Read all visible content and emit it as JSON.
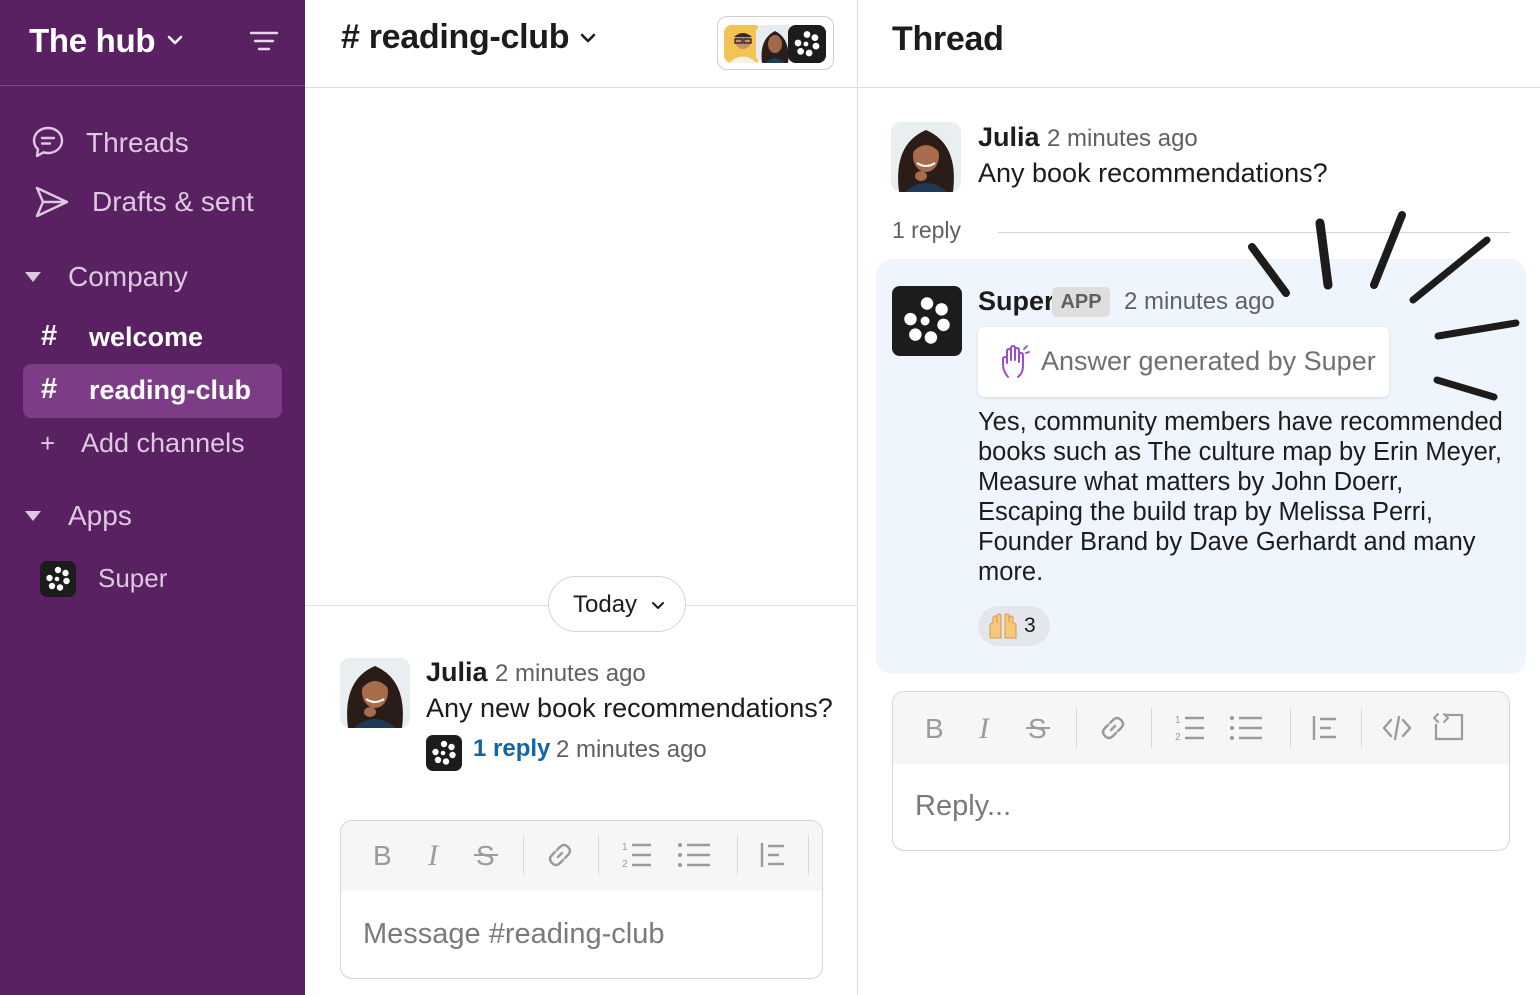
{
  "sidebar": {
    "workspace": "The hub",
    "nav": [
      {
        "label": "Threads",
        "icon": "threads-icon"
      },
      {
        "label": "Drafts & sent",
        "icon": "send-icon"
      }
    ],
    "sections": [
      {
        "label": "Company",
        "icon": "caret-down-icon"
      },
      {
        "label": "Apps",
        "icon": "caret-down-icon"
      }
    ],
    "channels": [
      {
        "hash": "#",
        "label": "welcome",
        "active": false
      },
      {
        "hash": "#",
        "label": "reading-club",
        "active": true
      }
    ],
    "add_channels": {
      "plus": "+",
      "label": "Add channels"
    },
    "apps": [
      {
        "label": "Super",
        "icon": "super-app-icon"
      }
    ]
  },
  "channel": {
    "title": "# reading-club",
    "day_divider": "Today",
    "message": {
      "user": "Julia",
      "time": "2 minutes ago",
      "text": "Any new book recommendations?",
      "reply_link": "1 reply",
      "reply_time": "2 minutes ago"
    },
    "composer": {
      "placeholder": "Message  #reading-club",
      "toolbar": [
        "B",
        "I",
        "S",
        "link",
        "numbered-list",
        "bulleted-list",
        "blockquote"
      ]
    }
  },
  "thread": {
    "title": "Thread",
    "parent": {
      "user": "Julia",
      "time": "2 minutes ago",
      "text": "Any book recommendations?"
    },
    "reply_count": "1 reply",
    "reply": {
      "user": "Super",
      "badge": "APP",
      "time": "2 minutes ago",
      "generated_label": "Answer generated by Super",
      "answer_lines": [
        "Yes, community members have recommended",
        "books such as The culture map by Erin Meyer,",
        "Measure what matters by John Doerr,",
        "Escaping the build trap by  Melissa Perri,",
        "Founder Brand by Dave Gerhardt and many",
        "more."
      ],
      "reaction": {
        "emoji": "🙌",
        "count": "3"
      }
    },
    "composer": {
      "placeholder": "Reply...",
      "toolbar": [
        "B",
        "I",
        "S",
        "link",
        "numbered-list",
        "bulleted-list",
        "blockquote",
        "code",
        "code-block"
      ]
    }
  },
  "colors": {
    "sidebar_bg": "#5a2162",
    "active_channel_bg": "#7c3d86",
    "link_blue": "#1264a3",
    "thread_highlight_bg": "#eff5fc",
    "accent_purple": "#9b4dca"
  }
}
